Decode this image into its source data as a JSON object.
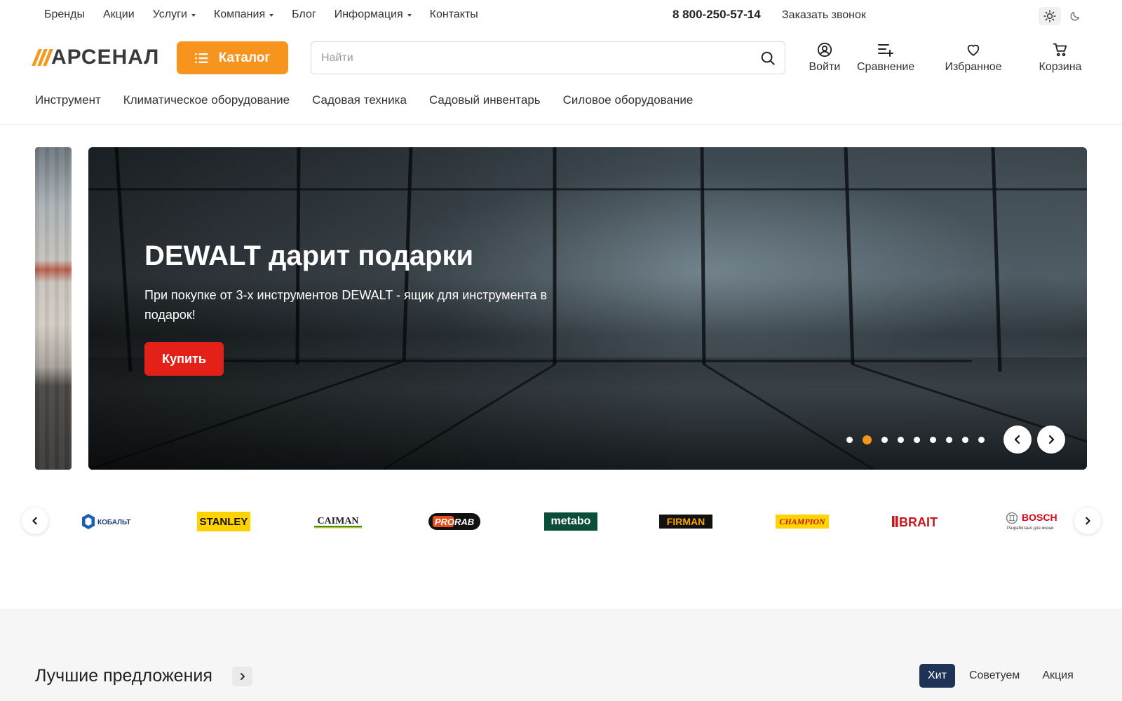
{
  "topnav": {
    "items": [
      {
        "label": "Бренды",
        "dropdown": false
      },
      {
        "label": "Акции",
        "dropdown": false
      },
      {
        "label": "Услуги",
        "dropdown": true
      },
      {
        "label": "Компания",
        "dropdown": true
      },
      {
        "label": "Блог",
        "dropdown": false
      },
      {
        "label": "Информация",
        "dropdown": true
      },
      {
        "label": "Контакты",
        "dropdown": false
      }
    ],
    "phone": "8 800-250-57-14",
    "callback": "Заказать звонок",
    "theme": {
      "active": "light",
      "icons": [
        "sun-icon",
        "moon-icon"
      ]
    }
  },
  "header": {
    "logo_text": "АРСЕНАЛ",
    "catalog_label": "Каталог",
    "search": {
      "placeholder": "Найти",
      "value": ""
    },
    "actions": {
      "login": "Войти",
      "compare": "Сравнение",
      "favorites": "Избранное",
      "cart": "Корзина"
    }
  },
  "categories": [
    "Инструмент",
    "Климатическое оборудование",
    "Садовая техника",
    "Садовый инвентарь",
    "Силовое оборудование"
  ],
  "hero": {
    "title": "DEWALT дарит подарки",
    "subtitle": "При покупке от 3-х инструментов DEWALT - ящик для инструмента в подарок!",
    "button": "Купить",
    "slides_total": 9,
    "active_slide": 2
  },
  "brands": {
    "items": [
      {
        "name": "КОБАЛЬТ",
        "style": "kobalt"
      },
      {
        "name": "STANLEY",
        "style": "stanley"
      },
      {
        "name": "CAIMAN",
        "style": "caiman"
      },
      {
        "name": "PRORAB",
        "style": "prorab"
      },
      {
        "name": "metabo",
        "style": "metabo"
      },
      {
        "name": "FIRMAN",
        "style": "firman"
      },
      {
        "name": "CHAMPION",
        "style": "champion"
      },
      {
        "name": "BRAIT",
        "style": "brait"
      },
      {
        "name": "BOSCH",
        "style": "bosch",
        "tagline": "Разработано для жизни"
      }
    ]
  },
  "offers": {
    "title": "Лучшие предложения",
    "tabs": [
      {
        "label": "Хит",
        "active": true
      },
      {
        "label": "Советуем",
        "active": false
      },
      {
        "label": "Акция",
        "active": false
      }
    ]
  },
  "colors": {
    "accent": "#f7941d",
    "buy_button": "#e32119",
    "active_tab": "#1f3356"
  }
}
